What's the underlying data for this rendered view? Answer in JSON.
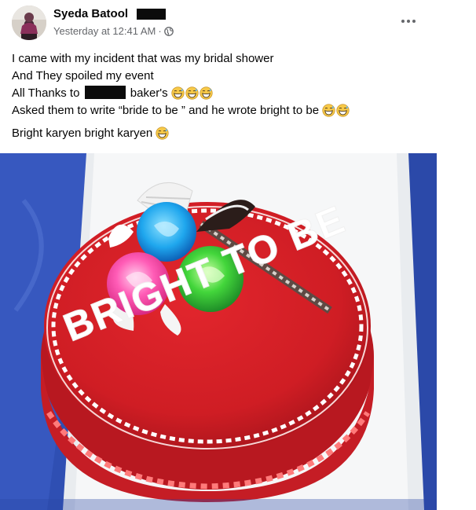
{
  "post": {
    "author": "Syeda Batool",
    "timestamp": "Yesterday at 12:41 AM",
    "separator": "·",
    "privacy_icon": "globe-icon",
    "menu_icon": "more-options-icon",
    "lines": {
      "l1": "I came with my incident that was my bridal shower",
      "l2": "And They spoiled my event",
      "l3_prefix": "All Thanks to",
      "l3_suffix": "baker's",
      "l4": "Asked them to write “bride to be ” and he wrote bright to be",
      "l5": "Bright karyen bright karyen"
    },
    "emoji_icon": "grinning-sweat-emoji-icon",
    "photo": {
      "subject": "red-cake-photo",
      "cake_text": "BRIGHT TO BE"
    }
  },
  "colors": {
    "name": "#050505",
    "meta": "#65676b",
    "cake_red": "#d42027",
    "table_blue": "#2f4fb3"
  }
}
